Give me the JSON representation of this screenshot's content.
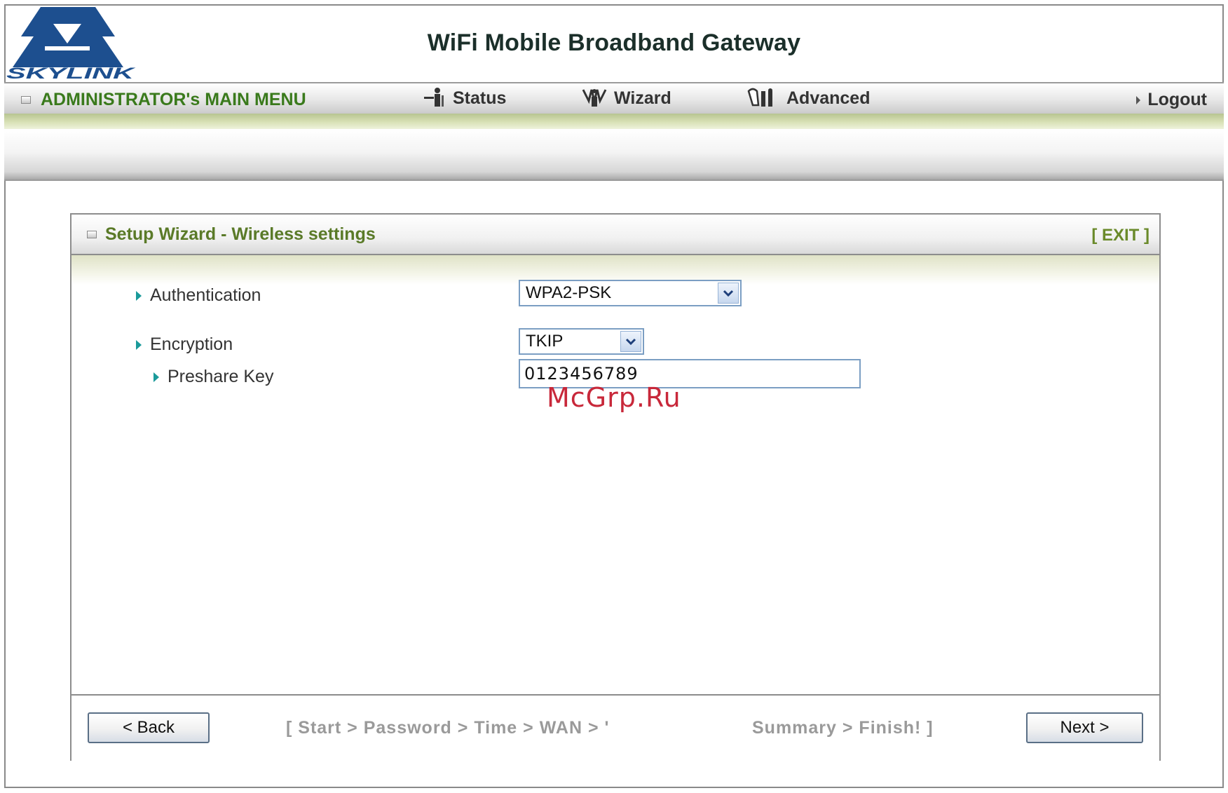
{
  "header": {
    "logo_text": "SKYLINK",
    "title": "WiFi Mobile Broadband Gateway"
  },
  "menu": {
    "title": "ADMINISTRATOR's MAIN MENU",
    "items": [
      {
        "label": "Status",
        "icon": "status-person-icon"
      },
      {
        "label": "Wizard",
        "icon": "wizard-icon"
      },
      {
        "label": "Advanced",
        "icon": "advanced-icon"
      }
    ],
    "logout": "Logout"
  },
  "panel": {
    "title": "Setup Wizard - Wireless settings",
    "exit": "[ EXIT ]",
    "fields": {
      "authentication": {
        "label": "Authentication",
        "value": "WPA2-PSK"
      },
      "encryption": {
        "label": "Encryption",
        "value": "TKIP"
      },
      "preshare_key": {
        "label": "Preshare Key",
        "value": "0123456789"
      }
    },
    "watermark": "McGrp.Ru"
  },
  "footer": {
    "back": "< Back",
    "next": "Next >",
    "steps_left": "[ Start > Password > Time > WAN > '",
    "steps_right": "Summary > Finish! ]"
  },
  "colors": {
    "logo_blue": "#1d4f8f",
    "menu_green": "#3a7a1c",
    "panel_title_green": "#5a7a28",
    "arrow_teal": "#1a9a9a",
    "watermark_red": "#c8283a"
  }
}
